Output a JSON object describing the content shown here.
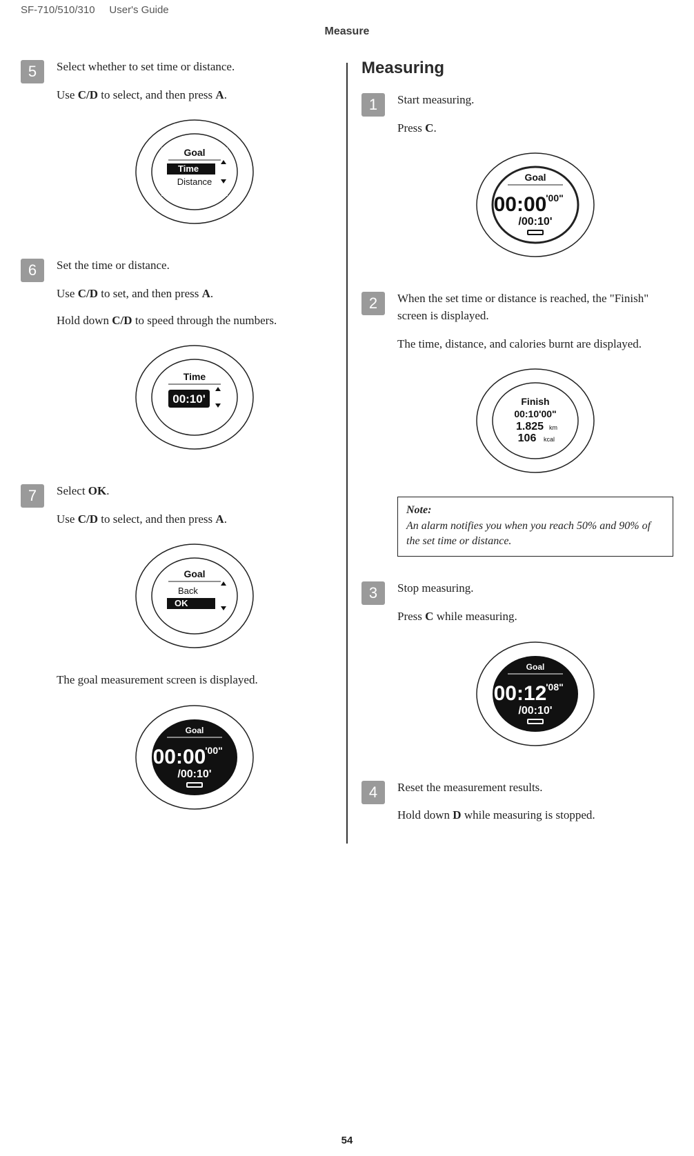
{
  "header": {
    "model": "SF-710/510/310",
    "doc_type": "User's Guide",
    "section": "Measure"
  },
  "left": {
    "step5": {
      "num": "5",
      "lead": "Select whether to set time or distance.",
      "line2_pre": "Use ",
      "line2_b1": "C/D",
      "line2_mid": " to select, and then press ",
      "line2_b2": "A",
      "line2_post": ".",
      "watch": {
        "title": "Goal",
        "item_sel": "Time",
        "item2": "Distance"
      }
    },
    "step6": {
      "num": "6",
      "lead": "Set the time or distance.",
      "line2_pre": "Use ",
      "line2_b1": "C/D",
      "line2_mid": " to set, and then press ",
      "line2_b2": "A",
      "line2_post": ".",
      "line3_pre": "Hold down ",
      "line3_b1": "C/D",
      "line3_post": " to speed through the numbers.",
      "watch": {
        "title": "Time",
        "value": "00:10'"
      }
    },
    "step7": {
      "num": "7",
      "lead_pre": "Select ",
      "lead_b": "OK",
      "lead_post": ".",
      "line2_pre": "Use ",
      "line2_b1": "C/D",
      "line2_mid": " to select, and then press ",
      "line2_b2": "A",
      "line2_post": ".",
      "watch": {
        "title": "Goal",
        "item1": "Back",
        "item_sel": "OK"
      },
      "after": "The goal measurement screen is displayed.",
      "watch2": {
        "title": "Goal",
        "big": "00:00",
        "sup": "'00\"",
        "sub": "/00:10'"
      }
    }
  },
  "right": {
    "h2": "Measuring",
    "step1": {
      "num": "1",
      "lead": "Start measuring.",
      "line2_pre": "Press ",
      "line2_b1": "C",
      "line2_post": ".",
      "watch": {
        "title": "Goal",
        "big": "00:00",
        "sup": "'00\"",
        "sub": "/00:10'"
      }
    },
    "step2": {
      "num": "2",
      "lead": "When the set time or distance is reached, the \"Finish\" screen is displayed.",
      "line2": "The time, distance, and calories burnt are displayed.",
      "watch": {
        "title": "Finish",
        "l1": "00:10'00\"",
        "l2": "1.825",
        "l2u": "km",
        "l3": "106",
        "l3u": "kcal"
      }
    },
    "note": {
      "label": "Note:",
      "text": "An alarm notifies you when you reach 50% and 90% of the set time or distance."
    },
    "step3": {
      "num": "3",
      "lead": "Stop measuring.",
      "line2_pre": "Press ",
      "line2_b1": "C",
      "line2_post": " while measuring.",
      "watch": {
        "title": "Goal",
        "big": "00:12",
        "sup": "'08\"",
        "sub": "/00:10'"
      }
    },
    "step4": {
      "num": "4",
      "lead": "Reset the measurement results.",
      "line2_pre": "Hold down ",
      "line2_b1": "D",
      "line2_post": " while measuring is stopped."
    }
  },
  "page_number": "54"
}
